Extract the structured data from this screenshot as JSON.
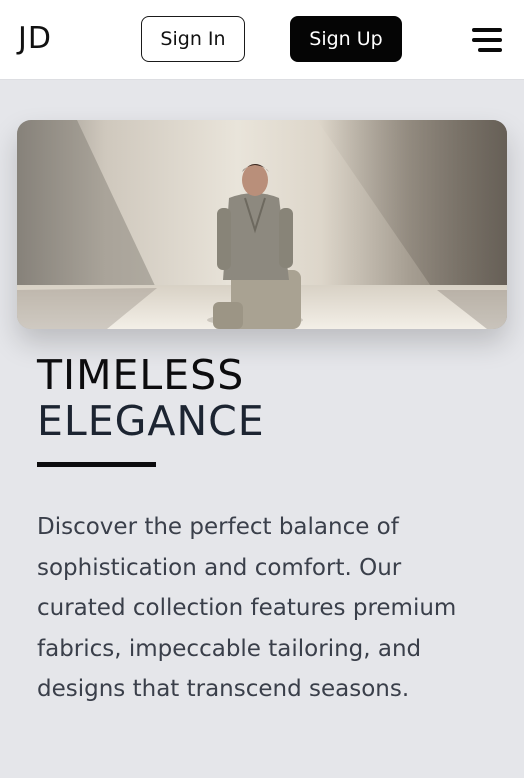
{
  "header": {
    "logo": "JD",
    "sign_in_label": "Sign In",
    "sign_up_label": "Sign Up",
    "menu_icon": "hamburger-menu-icon"
  },
  "hero": {
    "image_subject": "model-seated-photo"
  },
  "content": {
    "title_line1": "TIMELESS",
    "title_line2": "ELEGANCE",
    "description": "Discover the perfect balance of sophistication and comfort. Our curated collection features premium fabrics, impeccable tailoring, and designs that transcend seasons."
  },
  "colors": {
    "background": "#e5e6ea",
    "header_bg": "#ffffff",
    "primary_button": "#050505",
    "text_dark": "#0c0c0e",
    "text_body": "#3a3f4a"
  }
}
